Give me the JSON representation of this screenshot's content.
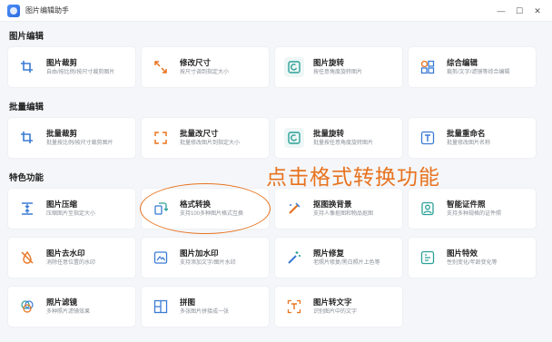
{
  "app": {
    "title": "图片编辑助手"
  },
  "window_controls": {
    "minimize": "—",
    "maximize": "☐",
    "close": "✕"
  },
  "sections": [
    {
      "title": "图片编辑",
      "items": [
        {
          "title": "图片裁剪",
          "desc": "自由/按比例/按尺寸裁剪图片",
          "icon": "crop-icon"
        },
        {
          "title": "修改尺寸",
          "desc": "按尺寸调到指定大小",
          "icon": "resize-icon"
        },
        {
          "title": "图片旋转",
          "desc": "按任意角度旋转图片",
          "icon": "rotate-icon"
        },
        {
          "title": "综合编辑",
          "desc": "裁剪/文字/滤镜等综合编辑",
          "icon": "shapes-icon"
        }
      ]
    },
    {
      "title": "批量编辑",
      "items": [
        {
          "title": "批量裁剪",
          "desc": "批量按比例/按尺寸裁剪图片",
          "icon": "batch-crop-icon"
        },
        {
          "title": "批量改尺寸",
          "desc": "批量修改图片到指定大小",
          "icon": "batch-resize-icon"
        },
        {
          "title": "批量旋转",
          "desc": "批量按任意角度旋转图片",
          "icon": "batch-rotate-icon"
        },
        {
          "title": "批量重命名",
          "desc": "批量修改图片名称",
          "icon": "rename-icon"
        }
      ]
    },
    {
      "title": "特色功能",
      "items": [
        {
          "title": "图片压缩",
          "desc": "压缩图片至指定大小",
          "icon": "compress-icon"
        },
        {
          "title": "格式转换",
          "desc": "支持100多种图片格式互换",
          "icon": "convert-icon"
        },
        {
          "title": "抠图换背景",
          "desc": "支持人像抠图和物品抠图",
          "icon": "cutout-icon"
        },
        {
          "title": "智能证件照",
          "desc": "支持多种规格的证件照",
          "icon": "id-photo-icon"
        },
        {
          "title": "图片去水印",
          "desc": "消除任意位置的水印",
          "icon": "remove-watermark-icon"
        },
        {
          "title": "图片加水印",
          "desc": "支持添加文字/图片水印",
          "icon": "add-watermark-icon"
        },
        {
          "title": "照片修复",
          "desc": "老照片修复/黑白照片上色等",
          "icon": "magic-wand-icon"
        },
        {
          "title": "图片特效",
          "desc": "性别变化/年龄变化等",
          "icon": "effects-icon"
        },
        {
          "title": "照片滤镜",
          "desc": "多种照片滤镜效果",
          "icon": "filter-icon"
        },
        {
          "title": "拼图",
          "desc": "多张图片拼接成一张",
          "icon": "collage-icon"
        },
        {
          "title": "图片转文字",
          "desc": "识别图片中的文字",
          "icon": "ocr-icon"
        }
      ]
    }
  ],
  "annotation": {
    "text": "点击格式转换功能"
  },
  "colors": {
    "accent": "#e8731f",
    "icon_blue": "#3a7bd5",
    "icon_bg": "#eef4fd"
  }
}
